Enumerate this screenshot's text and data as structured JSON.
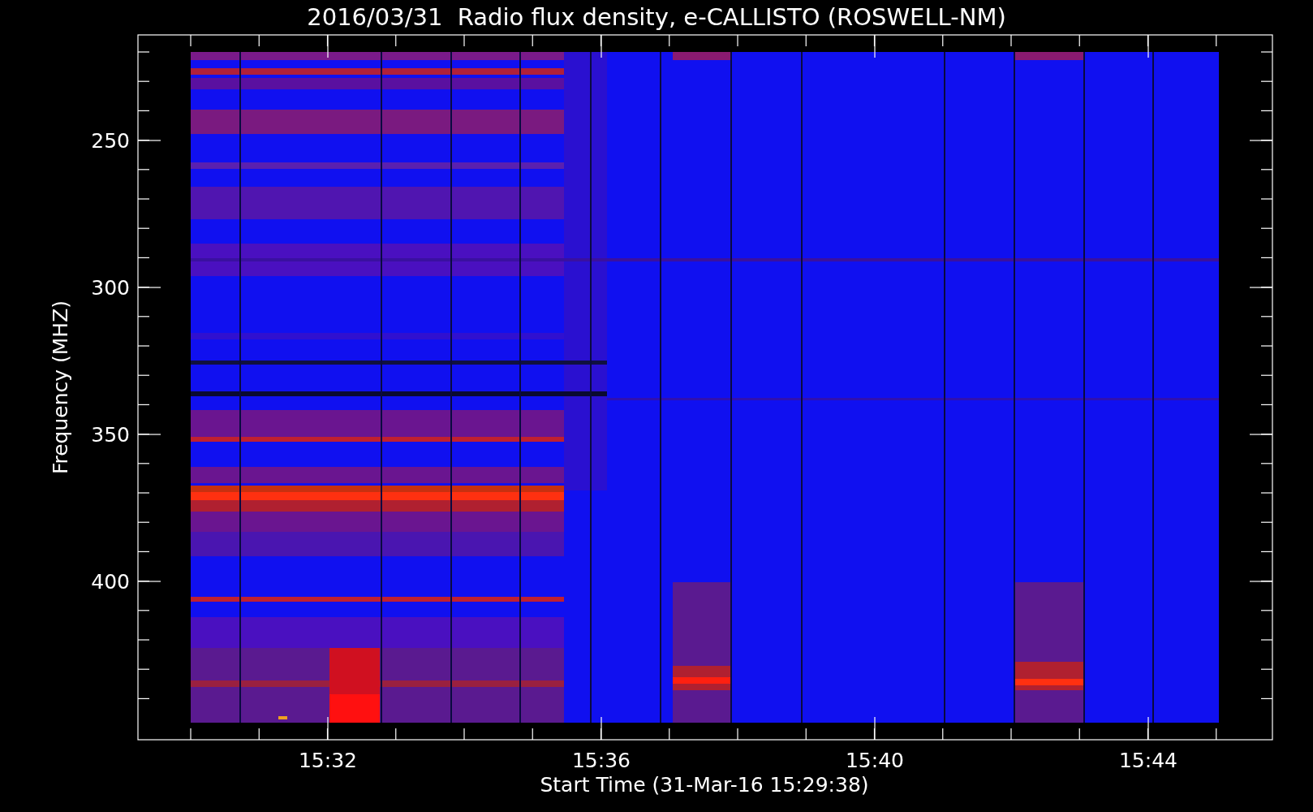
{
  "title": "2016/03/31  Radio flux density, e-CALLISTO (ROSWELL-NM)",
  "y_axis": {
    "label": "Frequency (MHZ)",
    "ticks": [
      "250",
      "300",
      "350",
      "400"
    ]
  },
  "x_axis": {
    "label": "Start Time (31-Mar-16 15:29:38)",
    "ticks": [
      "15:32",
      "15:36",
      "15:40",
      "15:44"
    ]
  }
}
